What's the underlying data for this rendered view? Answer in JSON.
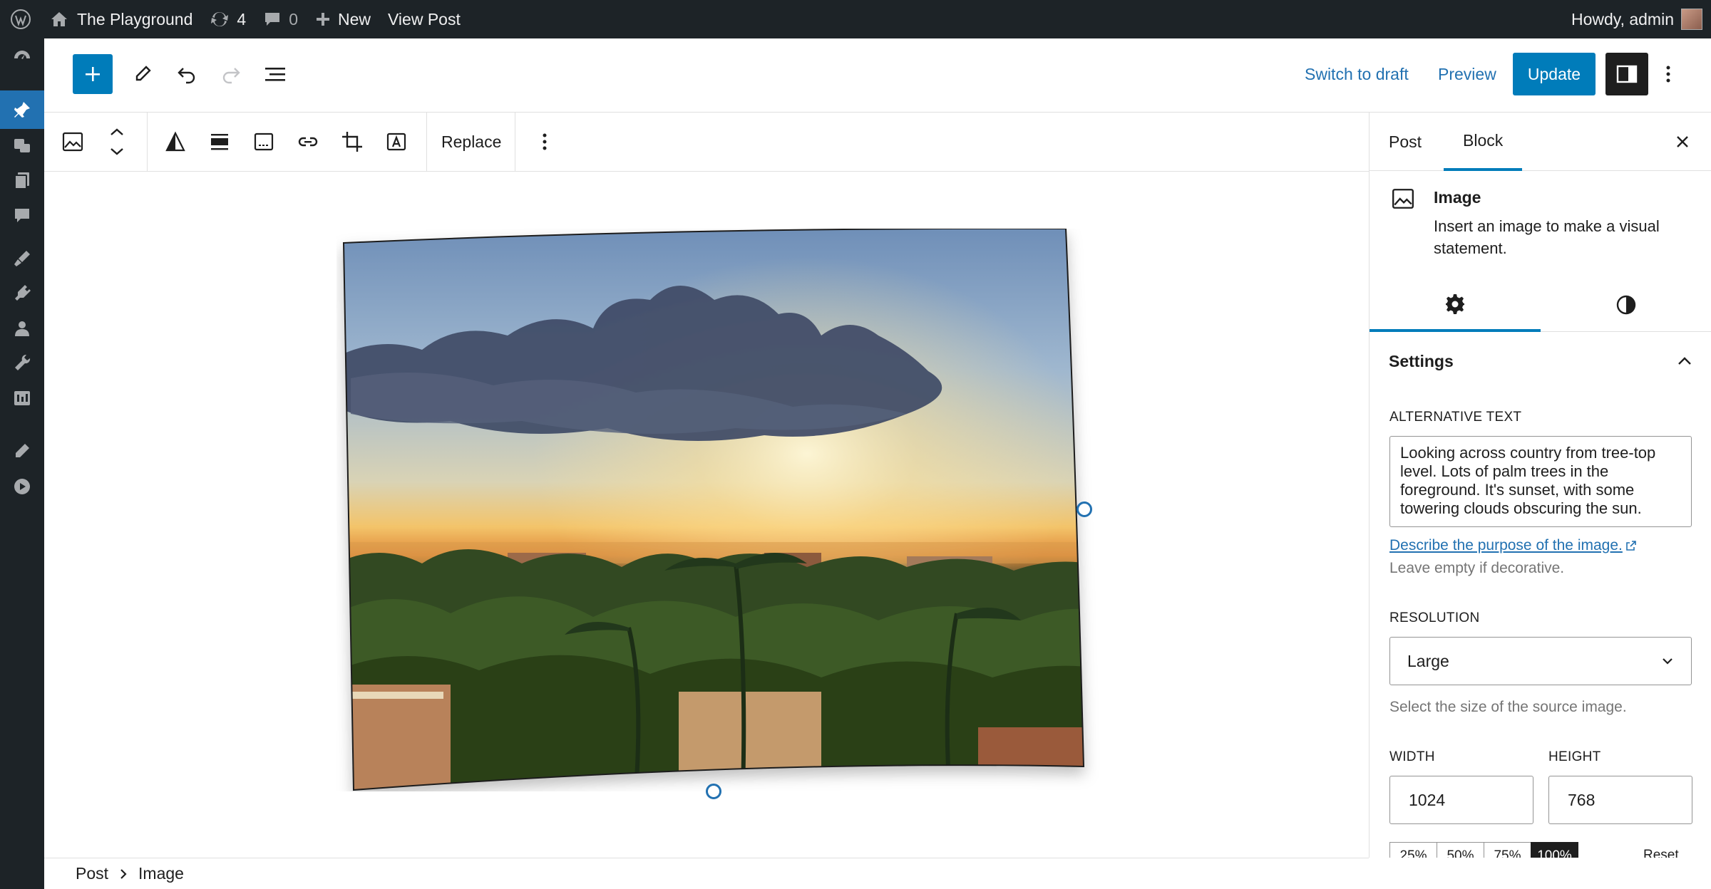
{
  "admin_bar": {
    "site_name": "The Playground",
    "updates_count": "4",
    "comments_count": "0",
    "new_label": "New",
    "view_post_label": "View Post",
    "greeting": "Howdy, admin"
  },
  "admin_menu": {
    "icons": [
      "dashboard-icon",
      "posts-icon",
      "media-icon",
      "pages-icon",
      "comments-icon",
      "appearance-icon",
      "plugins-icon",
      "users-icon",
      "tools-icon",
      "settings-icon",
      "custom-tool-icon",
      "video-icon"
    ],
    "active": "posts-icon"
  },
  "header": {
    "switch_to_draft": "Switch to draft",
    "preview": "Preview",
    "update": "Update"
  },
  "block_toolbar": {
    "replace_label": "Replace"
  },
  "canvas": {
    "image_description": "",
    "accent": "#2271b1"
  },
  "breadcrumb": {
    "items": [
      "Post",
      "Image"
    ]
  },
  "sidebar": {
    "tabs": [
      "Post",
      "Block"
    ],
    "active_tab": "Block",
    "block_card": {
      "title": "Image",
      "description": "Insert an image to make a visual statement."
    },
    "settings": {
      "title": "Settings",
      "alt_label": "ALTERNATIVE TEXT",
      "alt_value": "Looking across country from tree-top level. Lots of palm trees in the foreground. It's sunset, with some towering clouds obscuring the sun.",
      "alt_help_link": "Describe the purpose of the image.",
      "alt_help": "Leave empty if decorative.",
      "resolution_label": "RESOLUTION",
      "resolution_value": "Large",
      "resolution_help": "Select the size of the source image.",
      "width_label": "WIDTH",
      "height_label": "HEIGHT",
      "width_value": "1024",
      "height_value": "768",
      "scale_options": [
        "25%",
        "50%",
        "75%",
        "100%"
      ],
      "scale_selected": "100%",
      "reset_label": "Reset"
    }
  },
  "colors": {
    "admin_bg": "#1d2327",
    "primary": "#007cba",
    "link": "#2271b1"
  }
}
